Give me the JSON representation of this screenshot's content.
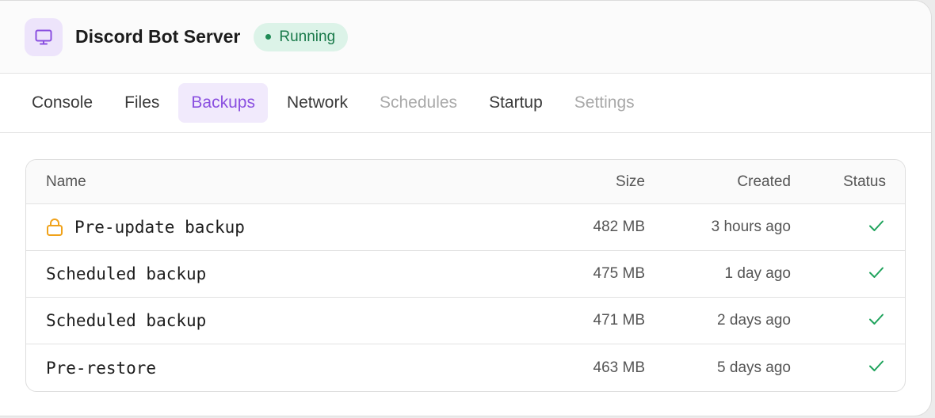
{
  "header": {
    "title": "Discord Bot Server",
    "status": "Running",
    "icon": "monitor-icon"
  },
  "tabs": [
    {
      "label": "Console",
      "state": "normal"
    },
    {
      "label": "Files",
      "state": "normal"
    },
    {
      "label": "Backups",
      "state": "active"
    },
    {
      "label": "Network",
      "state": "normal"
    },
    {
      "label": "Schedules",
      "state": "disabled"
    },
    {
      "label": "Startup",
      "state": "normal"
    },
    {
      "label": "Settings",
      "state": "disabled"
    }
  ],
  "table": {
    "columns": {
      "name": "Name",
      "size": "Size",
      "created": "Created",
      "status": "Status"
    },
    "rows": [
      {
        "name": "Pre-update backup",
        "size": "482 MB",
        "created": "3 hours ago",
        "locked": true,
        "status_icon": "check-icon"
      },
      {
        "name": "Scheduled backup",
        "size": "475 MB",
        "created": "1 day ago",
        "locked": false,
        "status_icon": "check-icon"
      },
      {
        "name": "Scheduled backup",
        "size": "471 MB",
        "created": "2 days ago",
        "locked": false,
        "status_icon": "check-icon"
      },
      {
        "name": "Pre-restore",
        "size": "463 MB",
        "created": "5 days ago",
        "locked": false,
        "status_icon": "check-icon"
      }
    ]
  },
  "colors": {
    "accent": "#8a4fe0",
    "accent_bg": "#f1eafc",
    "success": "#1fa35c",
    "lock": "#f0a21a"
  }
}
